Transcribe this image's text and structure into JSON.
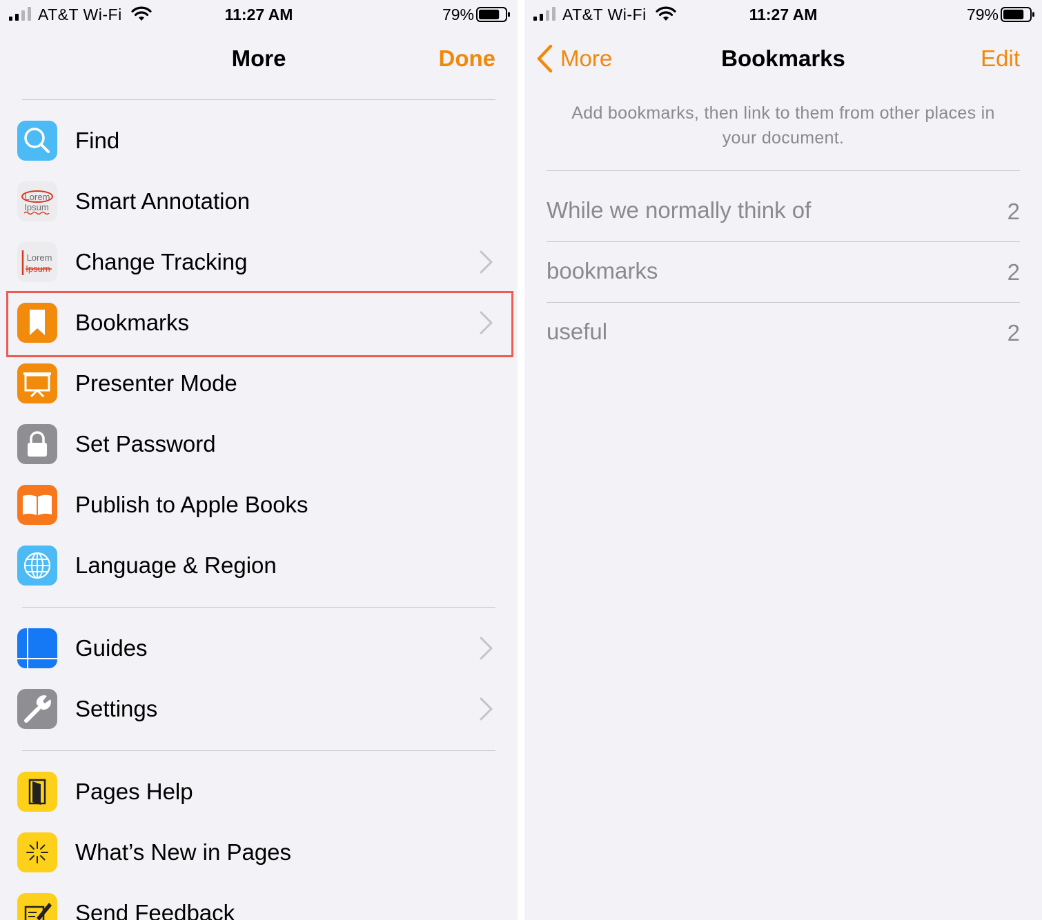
{
  "status_bar": {
    "carrier": "AT&T Wi-Fi",
    "time": "11:27 AM",
    "battery": "79%",
    "battery_level": 0.79
  },
  "left": {
    "nav": {
      "title": "More",
      "done_label": "Done"
    },
    "menu": [
      {
        "label": "Find",
        "icon": "magnifying-glass-icon",
        "chevron": false
      },
      {
        "label": "Smart Annotation",
        "icon": "smart-annotation-icon",
        "chevron": false
      },
      {
        "label": "Change Tracking",
        "icon": "change-tracking-icon",
        "chevron": true
      },
      {
        "label": "Bookmarks",
        "icon": "bookmark-icon",
        "chevron": true,
        "highlighted": true
      },
      {
        "label": "Presenter Mode",
        "icon": "presenter-icon",
        "chevron": false
      },
      {
        "label": "Set Password",
        "icon": "lock-icon",
        "chevron": false
      },
      {
        "label": "Publish to Apple Books",
        "icon": "book-icon",
        "chevron": false
      },
      {
        "label": "Language & Region",
        "icon": "globe-icon",
        "chevron": false
      },
      {
        "label": "Guides",
        "icon": "guides-icon",
        "chevron": true
      },
      {
        "label": "Settings",
        "icon": "wrench-icon",
        "chevron": true
      },
      {
        "label": "Pages Help",
        "icon": "help-book-icon",
        "chevron": false
      },
      {
        "label": "What’s New in Pages",
        "icon": "sparkle-icon",
        "chevron": false
      },
      {
        "label": "Send Feedback",
        "icon": "feedback-icon",
        "chevron": false
      }
    ],
    "icon_text": {
      "annotation_line1": "Lorem",
      "annotation_line2": "Ipsum",
      "tracking_line1": "Lorem",
      "tracking_line2": "Ipsum"
    }
  },
  "right": {
    "nav": {
      "back_label": "More",
      "title": "Bookmarks",
      "edit_label": "Edit"
    },
    "hint": "Add bookmarks, then link to them from other places in your document.",
    "bookmarks": [
      {
        "name": "While we normally think of",
        "page": "2"
      },
      {
        "name": "bookmarks",
        "page": "2"
      },
      {
        "name": "useful",
        "page": "2"
      }
    ]
  },
  "colors": {
    "accent": "#f0880a",
    "highlight_border": "#ef5b51",
    "background": "#f2f2f7",
    "secondary_text": "#8a8a8e"
  }
}
